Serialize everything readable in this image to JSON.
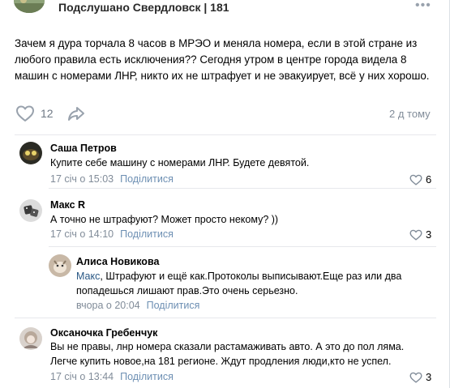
{
  "post": {
    "group_name": "Подслушано Свердловск | 181",
    "more_icon": "more-horizontal-icon",
    "text": "Зачем я дура торчала 8 часов в МРЭО и меняла номера, если в этой стране из любого правила есть исключения?? Сегодня утром в центре города видела 8 машин с номерами ЛНР, никто их не штрафует и не эвакуирует, всё у них хорошо.",
    "likes": "12",
    "time": "2 д тому"
  },
  "comments": [
    {
      "author": "Саша Петров",
      "text": "Купите себе машину с номерами ЛНР. Будете девятой.",
      "date": "17 січ о 15:03",
      "reply": "Поділитися",
      "likes": "6"
    },
    {
      "author": "Макс R",
      "text": "А точно не штрафуют? Может просто некому? ))",
      "date": "17 січ о 14:10",
      "reply": "Поділитися",
      "likes": "3"
    },
    {
      "author": "Алиса Новикова",
      "mention": "Макс",
      "text_after_mention": ", Штрафуют и ещё как.Протоколы выписывают.Еще раз или два попадешься лишают прав.Это очень серьезно.",
      "date": "вчора о 20:04",
      "reply": "Поділитися"
    },
    {
      "author": "Оксаночка Гребенчук",
      "text": "Вы не правы, лнр номера сказали растамаживать авто. А это до пол ляма. Легче купить новое,на 181 регионе. Ждут продления люди,кто не успел.",
      "date": "17 січ о 13:44",
      "reply": "Поділитися",
      "likes": "3"
    }
  ],
  "colors": {
    "link": "#6d8fb3",
    "secondary_text": "#818c99",
    "icon": "#99a2ad"
  }
}
